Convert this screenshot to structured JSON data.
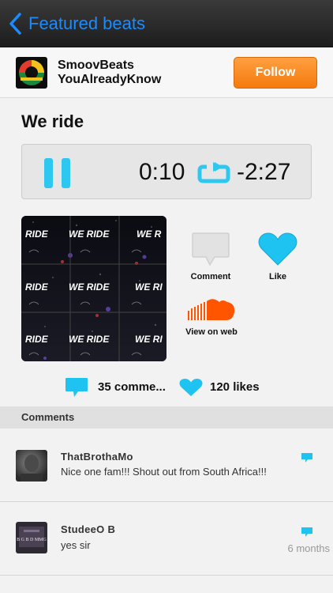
{
  "nav": {
    "title": "Featured beats"
  },
  "artist": {
    "name_line1": "SmoovBeats",
    "name_line2": "YouAlreadyKnow",
    "follow_label": "Follow"
  },
  "track": {
    "title": "We ride",
    "elapsed": "0:10",
    "remaining": "-2:27",
    "artwork_text": "WE RIDE",
    "artwork_side_text": "RIDE"
  },
  "actions": {
    "comment_label": "Comment",
    "like_label": "Like",
    "web_label": "View on web"
  },
  "stats": {
    "comments": "35 comme...",
    "likes": "120 likes"
  },
  "comments_section": {
    "header": "Comments",
    "items": [
      {
        "user": "ThatBrothaMo",
        "text": "Nice one fam!!! Shout out from South Africa!!!",
        "time": ""
      },
      {
        "user": "StudeeO B",
        "text": "yes sir",
        "time": "6 months",
        "avatar_text": "B G B D MMG"
      }
    ]
  },
  "colors": {
    "accent_blue": "#1a8cff",
    "cyan": "#2ec7f0",
    "orange": "#f57a0e",
    "soundcloud": "#ff5500"
  },
  "icons": [
    "chevron-left-icon",
    "pause-icon",
    "repeat-icon",
    "comment-bubble-icon",
    "heart-icon",
    "soundcloud-icon",
    "reply-icon"
  ]
}
